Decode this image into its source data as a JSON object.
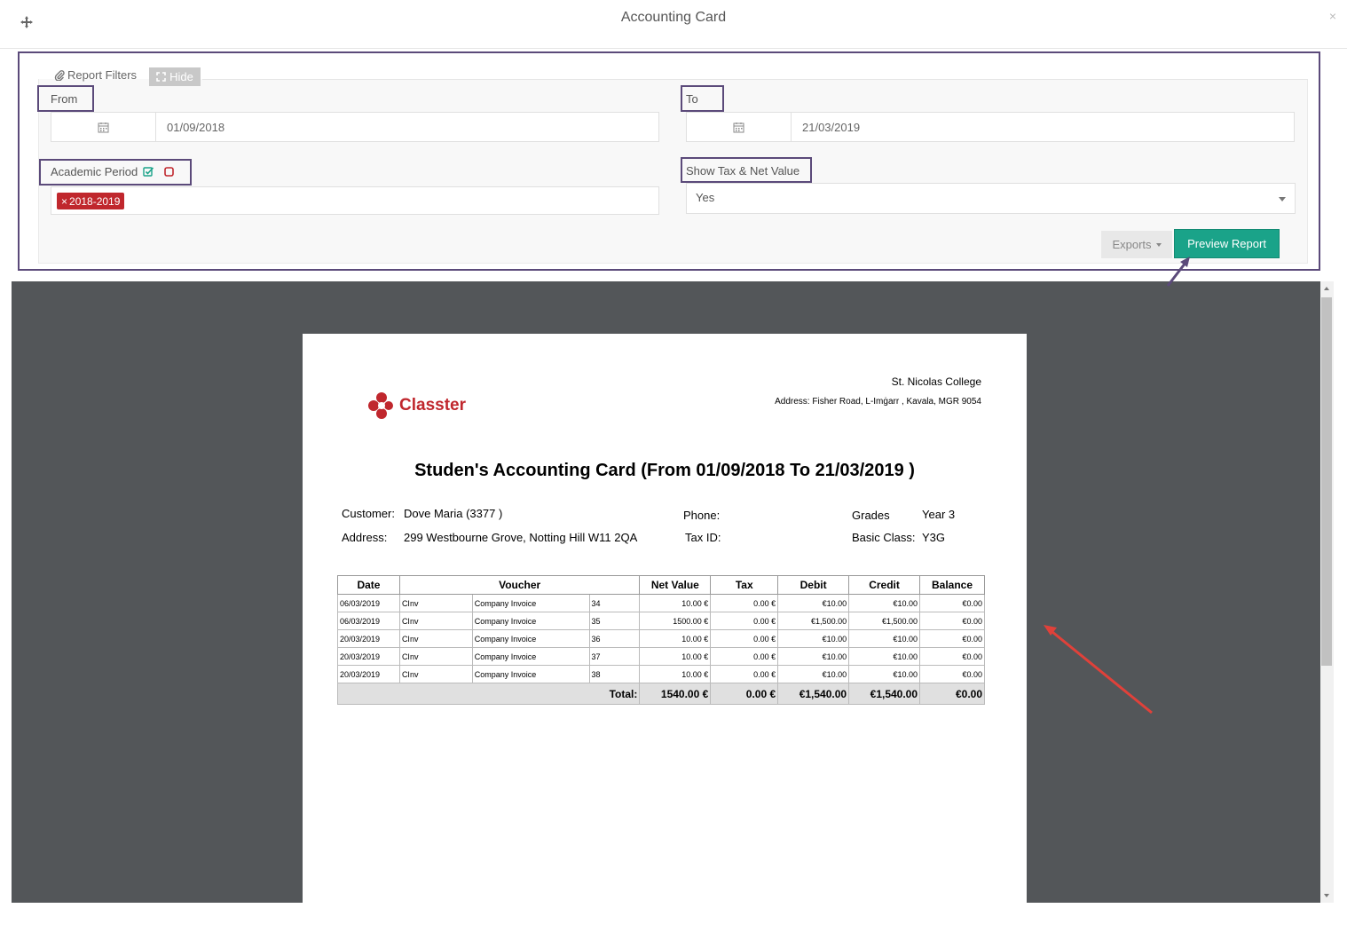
{
  "window": {
    "title": "Accounting Card",
    "close_symbol": "×"
  },
  "filters": {
    "tab_label": "Report Filters",
    "hide_label": "Hide",
    "from": {
      "label": "From",
      "value": "01/09/2018"
    },
    "to": {
      "label": "To",
      "value": "21/03/2019"
    },
    "academic_period": {
      "label": "Academic Period",
      "tag": "2018-2019",
      "tag_remove": "×"
    },
    "show_tax": {
      "label": "Show Tax & Net Value",
      "value": "Yes"
    },
    "exports_label": "Exports",
    "preview_label": "Preview Report"
  },
  "document": {
    "logo_text": "Classter",
    "college": "St. Nicolas College",
    "address": "Address: Fisher Road, L-Imġarr , Kavala, MGR 9054",
    "title": "Studen's Accounting Card (From 01/09/2018 To 21/03/2019 )",
    "customer_label": "Customer:",
    "customer_value": "Dove Maria (3377 )",
    "address_label": "Address:",
    "address_value": "299 Westbourne Grove, Notting Hill W11 2QA",
    "phone_label": "Phone:",
    "phone_value": "",
    "taxid_label": "Tax ID:",
    "taxid_value": "",
    "grades_label": "Grades",
    "grades_value": "Year 3",
    "class_label": "Basic Class:",
    "class_value": "Y3G",
    "columns": [
      "Date",
      "Voucher",
      "Net Value",
      "Tax",
      "Debit",
      "Credit",
      "Balance"
    ],
    "rows": [
      {
        "date": "06/03/2019",
        "code": "CInv",
        "type": "Company Invoice",
        "no": "34",
        "net": "10.00 €",
        "tax": "0.00 €",
        "debit": "€10.00",
        "credit": "€10.00",
        "balance": "€0.00"
      },
      {
        "date": "06/03/2019",
        "code": "CInv",
        "type": "Company Invoice",
        "no": "35",
        "net": "1500.00 €",
        "tax": "0.00 €",
        "debit": "€1,500.00",
        "credit": "€1,500.00",
        "balance": "€0.00"
      },
      {
        "date": "20/03/2019",
        "code": "CInv",
        "type": "Company Invoice",
        "no": "36",
        "net": "10.00 €",
        "tax": "0.00 €",
        "debit": "€10.00",
        "credit": "€10.00",
        "balance": "€0.00"
      },
      {
        "date": "20/03/2019",
        "code": "CInv",
        "type": "Company Invoice",
        "no": "37",
        "net": "10.00 €",
        "tax": "0.00 €",
        "debit": "€10.00",
        "credit": "€10.00",
        "balance": "€0.00"
      },
      {
        "date": "20/03/2019",
        "code": "CInv",
        "type": "Company Invoice",
        "no": "38",
        "net": "10.00 €",
        "tax": "0.00 €",
        "debit": "€10.00",
        "credit": "€10.00",
        "balance": "€0.00"
      }
    ],
    "total": {
      "label": "Total:",
      "net": "1540.00 €",
      "tax": "0.00 €",
      "debit": "€1,540.00",
      "credit": "€1,540.00",
      "balance": "€0.00"
    }
  },
  "colors": {
    "accent": "#1aa389",
    "tag": "#c0272d",
    "highlight": "#5b4a7a",
    "annotation_arrow": "#e0413a"
  },
  "icons": {
    "move": "move-icon",
    "paperclip": "paperclip-icon",
    "expand": "expand-icon",
    "calendar": "calendar-icon",
    "check": "check-square-icon",
    "uncheck": "square-icon"
  }
}
